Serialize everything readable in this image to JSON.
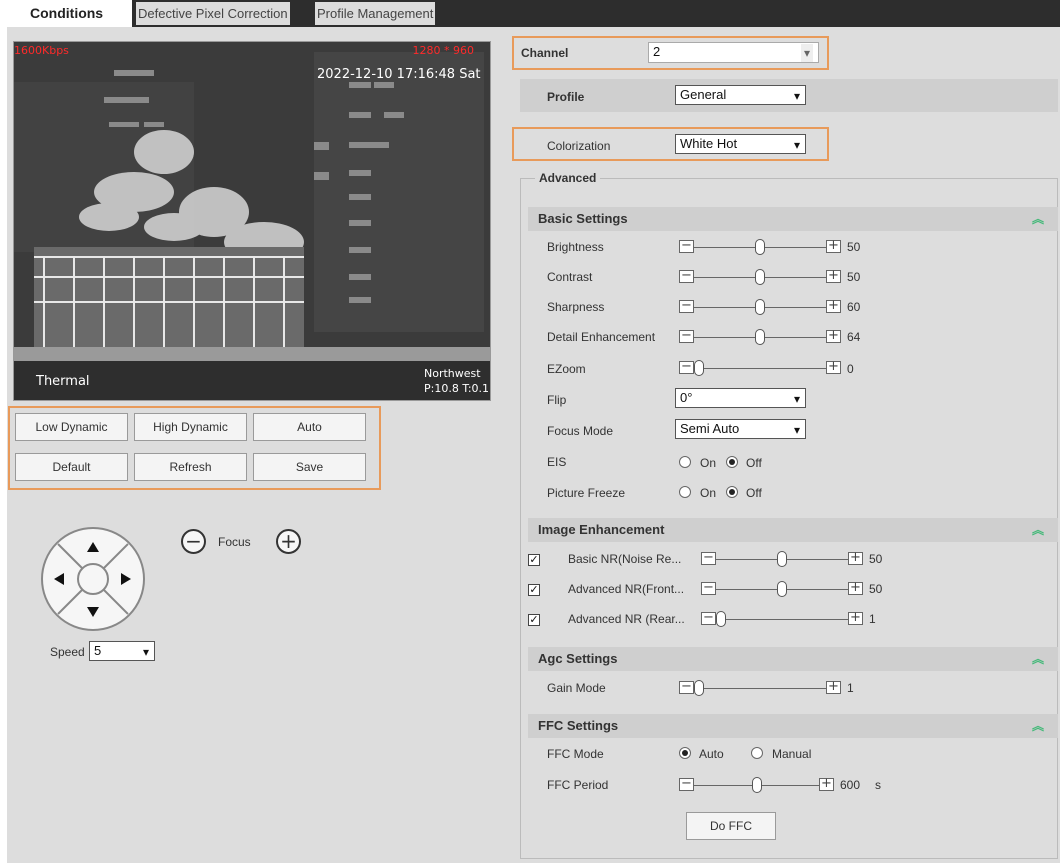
{
  "tabs": [
    "Conditions",
    "Defective Pixel Correction",
    "Profile Management"
  ],
  "video": {
    "bitrate": "1600Kbps",
    "resolution": "1280 * 960",
    "timestamp": "2022-12-10 17:16:48 Sat",
    "channel_label": "Thermal",
    "direction": "Northwest",
    "ptz_readout": "P:10.8 T:0.1"
  },
  "scene_buttons": [
    "Low Dynamic",
    "High Dynamic",
    "Auto"
  ],
  "action_buttons": [
    "Default",
    "Refresh",
    "Save"
  ],
  "ptz": {
    "focus_label": "Focus",
    "speed_label": "Speed",
    "speed_value": "5"
  },
  "channel": {
    "label": "Channel",
    "value": "2"
  },
  "profile": {
    "label": "Profile",
    "value": "General"
  },
  "colorization": {
    "label": "Colorization",
    "value": "White Hot"
  },
  "advanced_label": "Advanced",
  "basic": {
    "title": "Basic Settings",
    "brightness": {
      "label": "Brightness",
      "value": "50",
      "level": 0.5
    },
    "contrast": {
      "label": "Contrast",
      "value": "50",
      "level": 0.5
    },
    "sharpness": {
      "label": "Sharpness",
      "value": "60",
      "level": 0.5
    },
    "detail": {
      "label": "Detail Enhancement",
      "value": "64",
      "level": 0.5
    },
    "ezoom": {
      "label": "EZoom",
      "value": "0",
      "level": 0
    },
    "flip": {
      "label": "Flip",
      "value": "0°"
    },
    "focus_mode": {
      "label": "Focus Mode",
      "value": "Semi Auto"
    },
    "eis": {
      "label": "EIS",
      "on": "On",
      "off": "Off"
    },
    "freeze": {
      "label": "Picture Freeze",
      "on": "On",
      "off": "Off"
    }
  },
  "enhance": {
    "title": "Image Enhancement",
    "nr1": {
      "label": "Basic NR(Noise Re...",
      "value": "50",
      "level": 0.5
    },
    "nr2": {
      "label": "Advanced NR(Front...",
      "value": "50",
      "level": 0.5
    },
    "nr3": {
      "label": "Advanced NR (Rear...",
      "value": "1",
      "level": 0
    }
  },
  "agc": {
    "title": "Agc Settings",
    "gain": {
      "label": "Gain Mode",
      "value": "1",
      "level": 0
    }
  },
  "ffc": {
    "title": "FFC Settings",
    "mode": {
      "label": "FFC Mode",
      "auto": "Auto",
      "manual": "Manual"
    },
    "period": {
      "label": "FFC Period",
      "value": "600",
      "unit": "s",
      "level": 0.5
    },
    "button": "Do FFC"
  },
  "colors": {
    "accent_orange": "#e89a5a",
    "collapse_green": "#46b97a"
  }
}
